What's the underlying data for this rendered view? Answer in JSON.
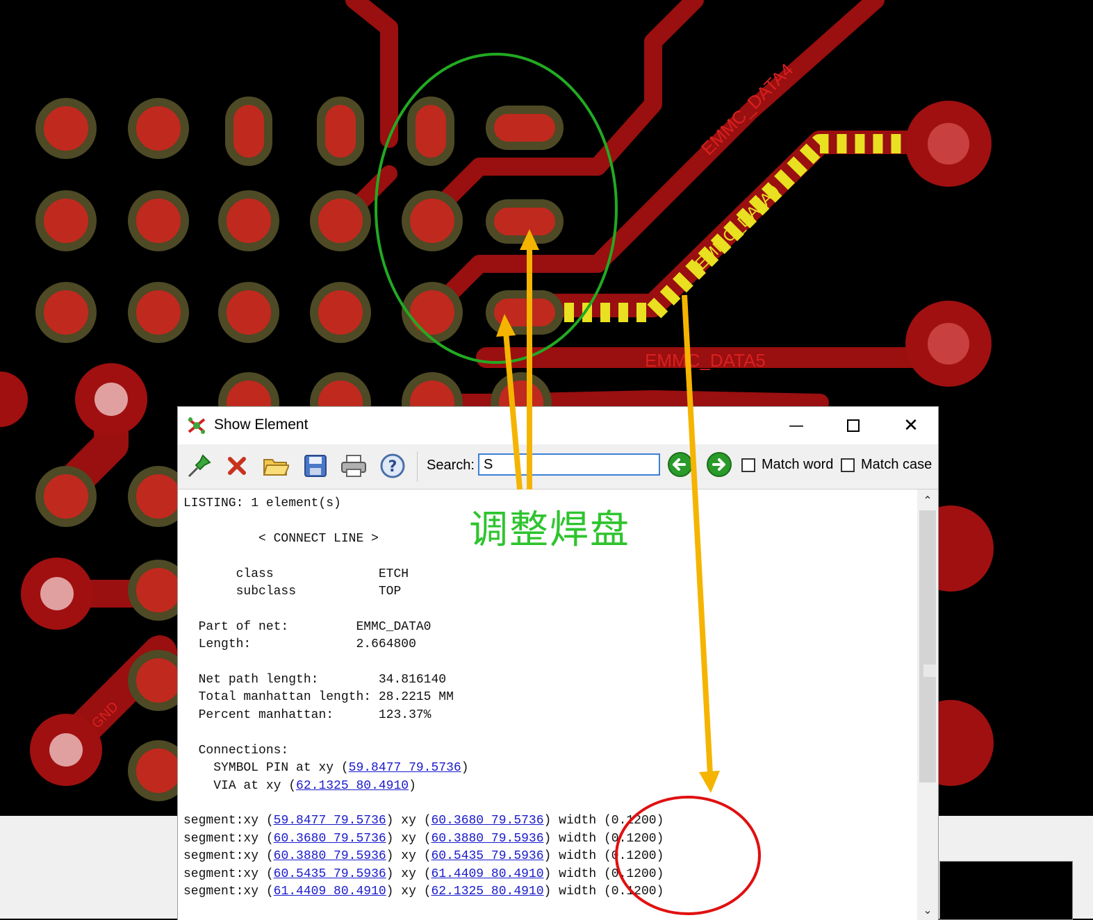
{
  "pcb": {
    "trace_labels": [
      "EMMC_DATA4",
      "EMMC_DATA0",
      "EMMC_DATA5"
    ],
    "pin_labels": [
      "GND"
    ],
    "colors": {
      "background": "#000000",
      "copper": "#b01010",
      "pad": "#cc2a1e",
      "pad_outline": "#4a4a2a",
      "highlight": "#e8e020",
      "via_center": "#e8a8a8"
    }
  },
  "dialog": {
    "title": "Show Element",
    "window_controls": {
      "minimize": "—",
      "maximize": "☐",
      "close": "✕"
    },
    "toolbar": {
      "icons": [
        "pin-icon",
        "delete-icon",
        "open-folder-icon",
        "save-icon",
        "print-icon",
        "help-icon"
      ],
      "search_label": "Search:",
      "search_value": "S",
      "match_word_label": "Match word",
      "match_case_label": "Match case",
      "match_word_checked": false,
      "match_case_checked": false
    },
    "listing": {
      "header": "LISTING: 1 element(s)",
      "element_type": "< CONNECT LINE >",
      "class_key": "class",
      "class_value": "ETCH",
      "subclass_key": "subclass",
      "subclass_value": "TOP",
      "part_of_net_key": "Part of net:",
      "part_of_net_value": "EMMC_DATA0",
      "length_key": "Length:",
      "length_value": "2.664800",
      "net_path_length_key": "Net path length:",
      "net_path_length_value": "34.816140",
      "total_manhattan_key": "Total manhattan length:",
      "total_manhattan_value": "28.2215 MM",
      "percent_manhattan_key": "Percent manhattan:",
      "percent_manhattan_value": "123.37%",
      "connections_key": "Connections:",
      "connections": [
        {
          "label": "SYMBOL PIN at xy",
          "xy": "59.8477 79.5736"
        },
        {
          "label": "VIA at xy",
          "xy": "62.1325 80.4910"
        }
      ],
      "segments": [
        {
          "from": "59.8477 79.5736",
          "to": "60.3680 79.5736",
          "width": "(0.1200)"
        },
        {
          "from": "60.3680 79.5736",
          "to": "60.3880 79.5936",
          "width": "(0.1200)"
        },
        {
          "from": "60.3880 79.5936",
          "to": "60.5435 79.5936",
          "width": "(0.1200)"
        },
        {
          "from": "60.5435 79.5936",
          "to": "61.4409 80.4910",
          "width": "(0.1200)"
        },
        {
          "from": "61.4409 80.4910",
          "to": "62.1325 80.4910",
          "width": "(0.1200)"
        }
      ],
      "segment_prefix": "segment:xy",
      "xy_word": "xy",
      "width_word": "width"
    }
  },
  "annotation": {
    "text": "调整焊盘",
    "colors": {
      "text": "#2ec42e",
      "ellipse_green": "#22aa22",
      "ellipse_red": "#e01010",
      "arrow": "#f5b400"
    }
  }
}
